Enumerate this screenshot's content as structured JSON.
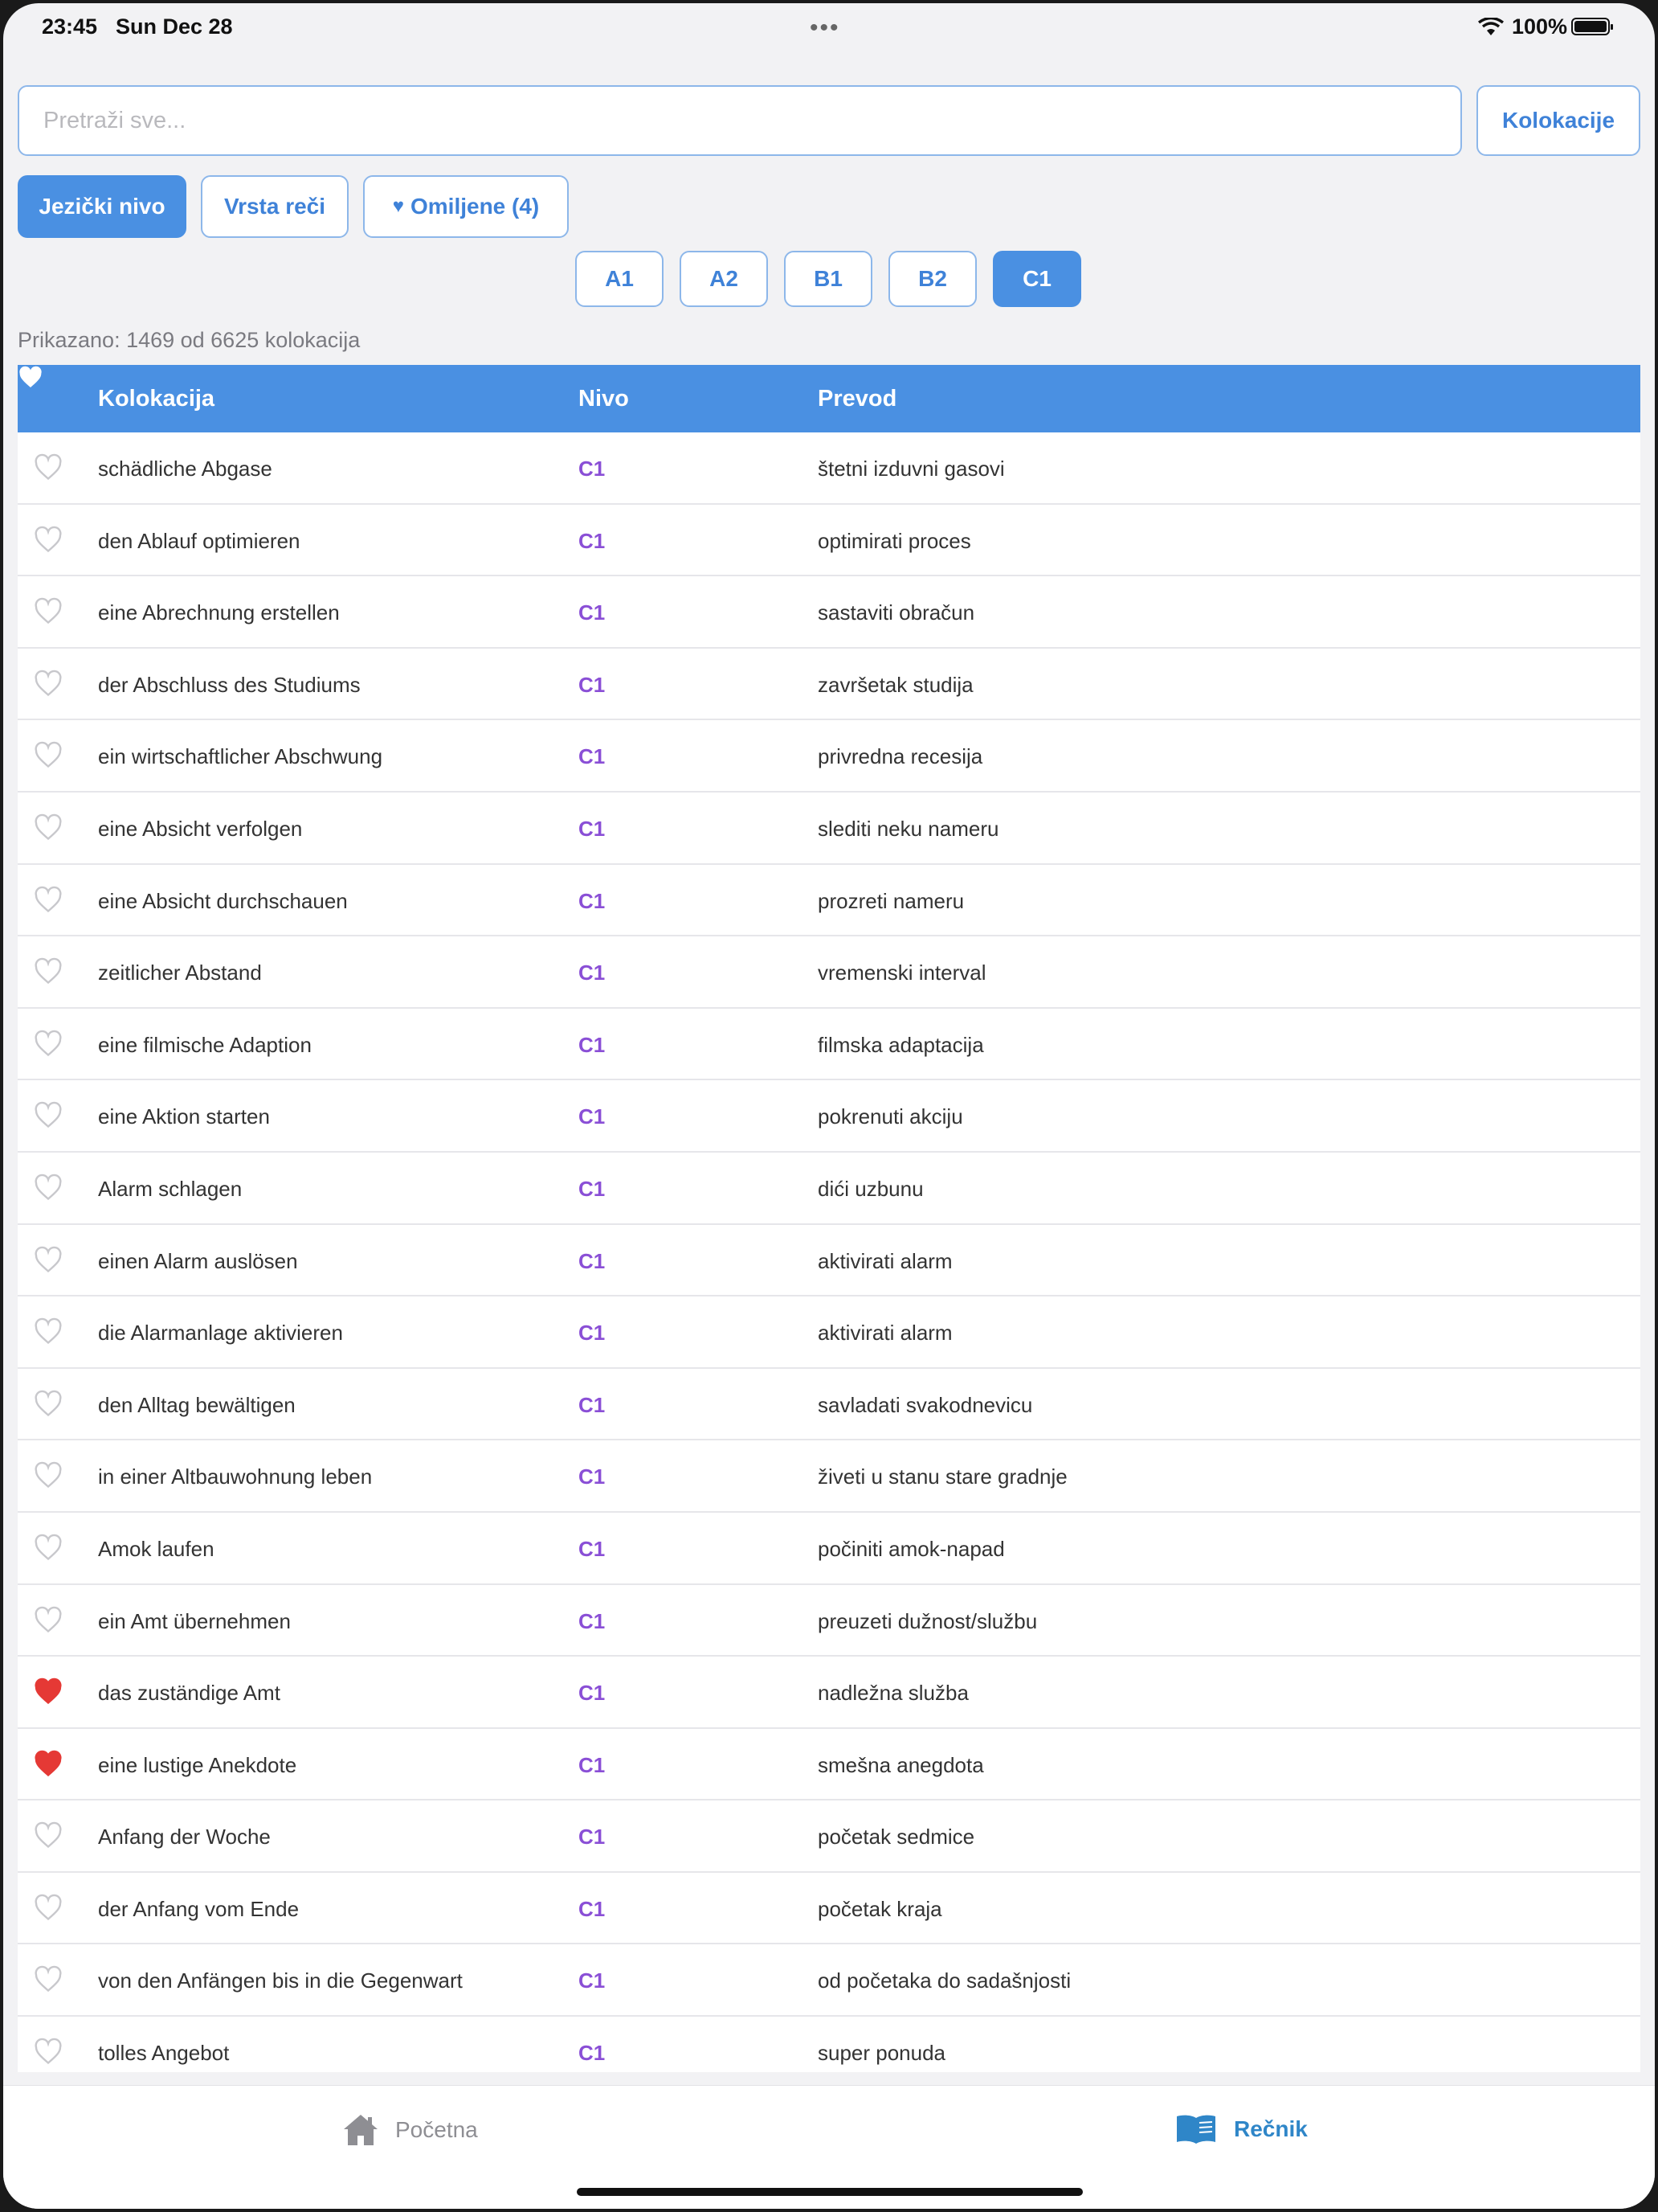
{
  "status_bar": {
    "time": "23:45",
    "date": "Sun Dec 28",
    "battery": "100%",
    "dots": "•••"
  },
  "search": {
    "placeholder": "Pretraži sve...",
    "value": "",
    "mode_button": "Kolokacije"
  },
  "filters": {
    "tabs": [
      {
        "label": "Jezički nivo",
        "active": true
      },
      {
        "label": "Vrsta reči",
        "active": false
      },
      {
        "label": "Omiljene (4)",
        "active": false
      }
    ],
    "levels": [
      {
        "label": "A1",
        "active": false
      },
      {
        "label": "A2",
        "active": false
      },
      {
        "label": "B1",
        "active": false
      },
      {
        "label": "B2",
        "active": false
      },
      {
        "label": "C1",
        "active": true
      }
    ]
  },
  "summary": "Prikazano: 1469 od 6625 kolokacija",
  "table": {
    "headers": {
      "collocation": "Kolokacija",
      "level": "Nivo",
      "translation": "Prevod"
    },
    "rows": [
      {
        "fav": false,
        "collocation": "schädliche Abgase",
        "level": "C1",
        "translation": "štetni izduvni gasovi"
      },
      {
        "fav": false,
        "collocation": "den Ablauf optimieren",
        "level": "C1",
        "translation": "optimirati proces"
      },
      {
        "fav": false,
        "collocation": "eine Abrechnung erstellen",
        "level": "C1",
        "translation": "sastaviti obračun"
      },
      {
        "fav": false,
        "collocation": "der Abschluss des Studiums",
        "level": "C1",
        "translation": "završetak studija"
      },
      {
        "fav": false,
        "collocation": "ein wirtschaftlicher Abschwung",
        "level": "C1",
        "translation": "privredna recesija"
      },
      {
        "fav": false,
        "collocation": "eine Absicht verfolgen",
        "level": "C1",
        "translation": "slediti neku nameru"
      },
      {
        "fav": false,
        "collocation": "eine Absicht durchschauen",
        "level": "C1",
        "translation": "prozreti nameru"
      },
      {
        "fav": false,
        "collocation": "zeitlicher Abstand",
        "level": "C1",
        "translation": "vremenski interval"
      },
      {
        "fav": false,
        "collocation": "eine filmische Adaption",
        "level": "C1",
        "translation": "filmska adaptacija"
      },
      {
        "fav": false,
        "collocation": "eine Aktion starten",
        "level": "C1",
        "translation": "pokrenuti akciju"
      },
      {
        "fav": false,
        "collocation": "Alarm schlagen",
        "level": "C1",
        "translation": "dići uzbunu"
      },
      {
        "fav": false,
        "collocation": "einen Alarm auslösen",
        "level": "C1",
        "translation": "aktivirati alarm"
      },
      {
        "fav": false,
        "collocation": "die Alarmanlage aktivieren",
        "level": "C1",
        "translation": "aktivirati alarm"
      },
      {
        "fav": false,
        "collocation": "den Alltag bewältigen",
        "level": "C1",
        "translation": "savladati svakodnevicu"
      },
      {
        "fav": false,
        "collocation": "in einer Altbauwohnung leben",
        "level": "C1",
        "translation": "živeti u stanu stare gradnje"
      },
      {
        "fav": false,
        "collocation": "Amok laufen",
        "level": "C1",
        "translation": "počiniti amok-napad"
      },
      {
        "fav": false,
        "collocation": "ein Amt übernehmen",
        "level": "C1",
        "translation": "preuzeti dužnost/službu"
      },
      {
        "fav": true,
        "collocation": "das zuständige Amt",
        "level": "C1",
        "translation": "nadležna služba"
      },
      {
        "fav": true,
        "collocation": "eine lustige Anekdote",
        "level": "C1",
        "translation": "smešna anegdota"
      },
      {
        "fav": false,
        "collocation": "Anfang der Woche",
        "level": "C1",
        "translation": "početak sedmice"
      },
      {
        "fav": false,
        "collocation": "der Anfang vom Ende",
        "level": "C1",
        "translation": "početak kraja"
      },
      {
        "fav": false,
        "collocation": "von den Anfängen bis in die Gegenwart",
        "level": "C1",
        "translation": "od početaka do sadašnjosti"
      },
      {
        "fav": false,
        "collocation": "tolles Angebot",
        "level": "C1",
        "translation": "super ponuda"
      }
    ]
  },
  "tab_bar": {
    "home": "Početna",
    "dictionary": "Rečnik"
  },
  "colors": {
    "accent": "#4a90e2",
    "level_text": "#8a4fd6",
    "favorite": "#e53935",
    "active_tab": "#2f86c8"
  },
  "icons": {
    "home": "house-icon",
    "dictionary": "book-icon",
    "favorite": "heart-icon"
  }
}
